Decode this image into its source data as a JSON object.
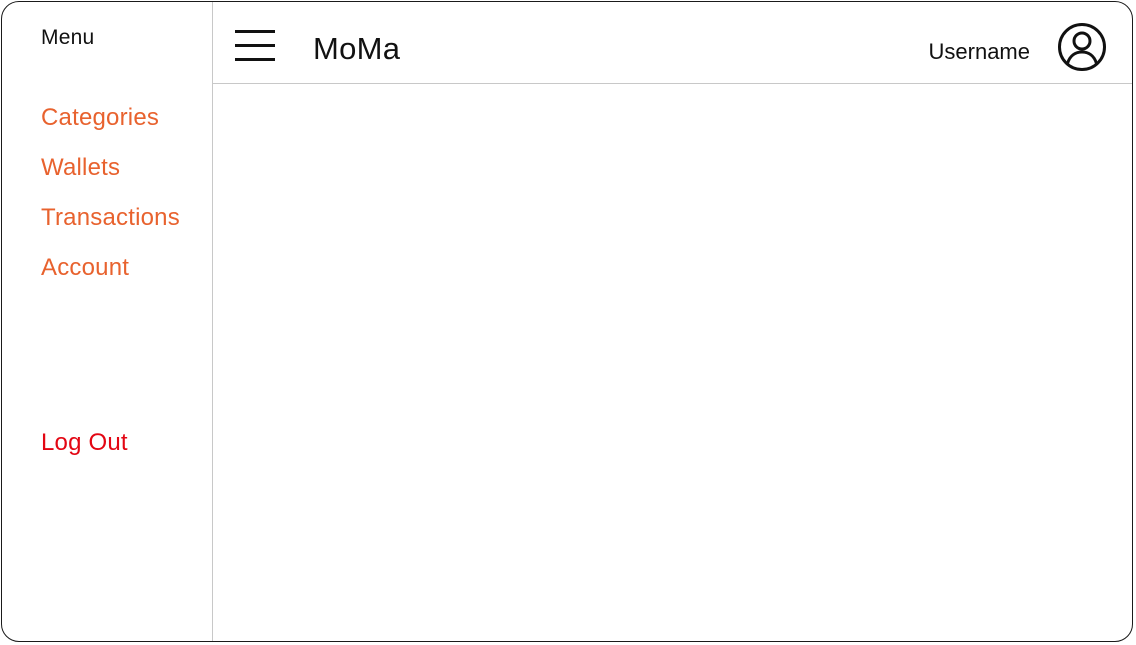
{
  "sidebar": {
    "title": "Menu",
    "items": [
      {
        "label": "Categories"
      },
      {
        "label": "Wallets"
      },
      {
        "label": "Transactions"
      },
      {
        "label": "Account"
      }
    ],
    "logout_label": "Log Out"
  },
  "header": {
    "menu_icon": "hamburger-menu-icon",
    "app_title": "MoMa",
    "username": "Username",
    "avatar_icon": "user-avatar-icon"
  },
  "colors": {
    "nav_accent": "#e8622e",
    "logout": "#e30613",
    "text": "#111111",
    "divider": "#c8c8c8"
  }
}
